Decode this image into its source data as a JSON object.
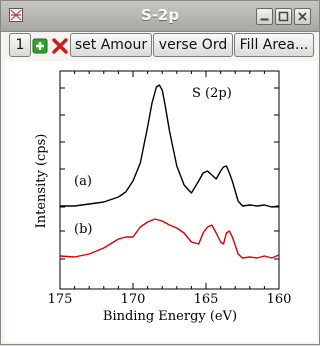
{
  "window": {
    "title": "S-2p"
  },
  "toolbar": {
    "count_label": "1",
    "add_icon": "plus-icon",
    "remove_icon": "x-icon",
    "buttons": [
      "set Amour",
      "verse Ord",
      "Fill Area..."
    ]
  },
  "colors": {
    "series_a": "#000000",
    "series_b": "#e00000",
    "add": "#2fa12f",
    "remove": "#d11a1a"
  },
  "chart_data": {
    "type": "line",
    "annotation": "S (2p)",
    "xlabel": "Binding Energy (eV)",
    "ylabel": "Intensity (cps)",
    "xlim": [
      175,
      160
    ],
    "xticks": [
      "175",
      "170",
      "165",
      "160"
    ],
    "grid": false,
    "series": [
      {
        "name": "(a)",
        "color": "#000000",
        "x": [
          175,
          174,
          173,
          172,
          171,
          170.5,
          170,
          169.5,
          169,
          168.7,
          168.4,
          168.2,
          168,
          167.8,
          167.5,
          167,
          166.5,
          166,
          165.5,
          165.2,
          164.9,
          164.6,
          164.3,
          164,
          163.8,
          163.6,
          163.4,
          163.2,
          163,
          162.8,
          162.5,
          162,
          161.5,
          161,
          160.5,
          160
        ],
        "y": [
          205,
          205,
          203,
          201,
          196,
          191,
          180,
          162,
          126,
          102,
          86,
          84,
          89,
          104,
          130,
          165,
          184,
          192,
          180,
          172,
          170,
          174,
          178,
          170,
          166,
          165,
          172,
          180,
          190,
          200,
          205,
          204,
          205,
          204,
          206,
          205
        ]
      },
      {
        "name": "(b)",
        "color": "#e00000",
        "x": [
          175,
          174,
          173,
          172,
          171,
          170.5,
          170,
          169.5,
          169,
          168.5,
          168,
          167.5,
          167,
          166.5,
          166,
          165.5,
          165.2,
          164.9,
          164.6,
          164.3,
          164,
          163.8,
          163.6,
          163.4,
          163.2,
          163,
          162.8,
          162.5,
          162,
          161.5,
          161,
          160.5,
          160
        ],
        "y": [
          255,
          256,
          253,
          247,
          238,
          236,
          236,
          226,
          221,
          218,
          220,
          224,
          227,
          232,
          241,
          243,
          232,
          226,
          224,
          232,
          241,
          243,
          232,
          230,
          236,
          244,
          253,
          257,
          256,
          257,
          255,
          257,
          254
        ]
      }
    ]
  }
}
